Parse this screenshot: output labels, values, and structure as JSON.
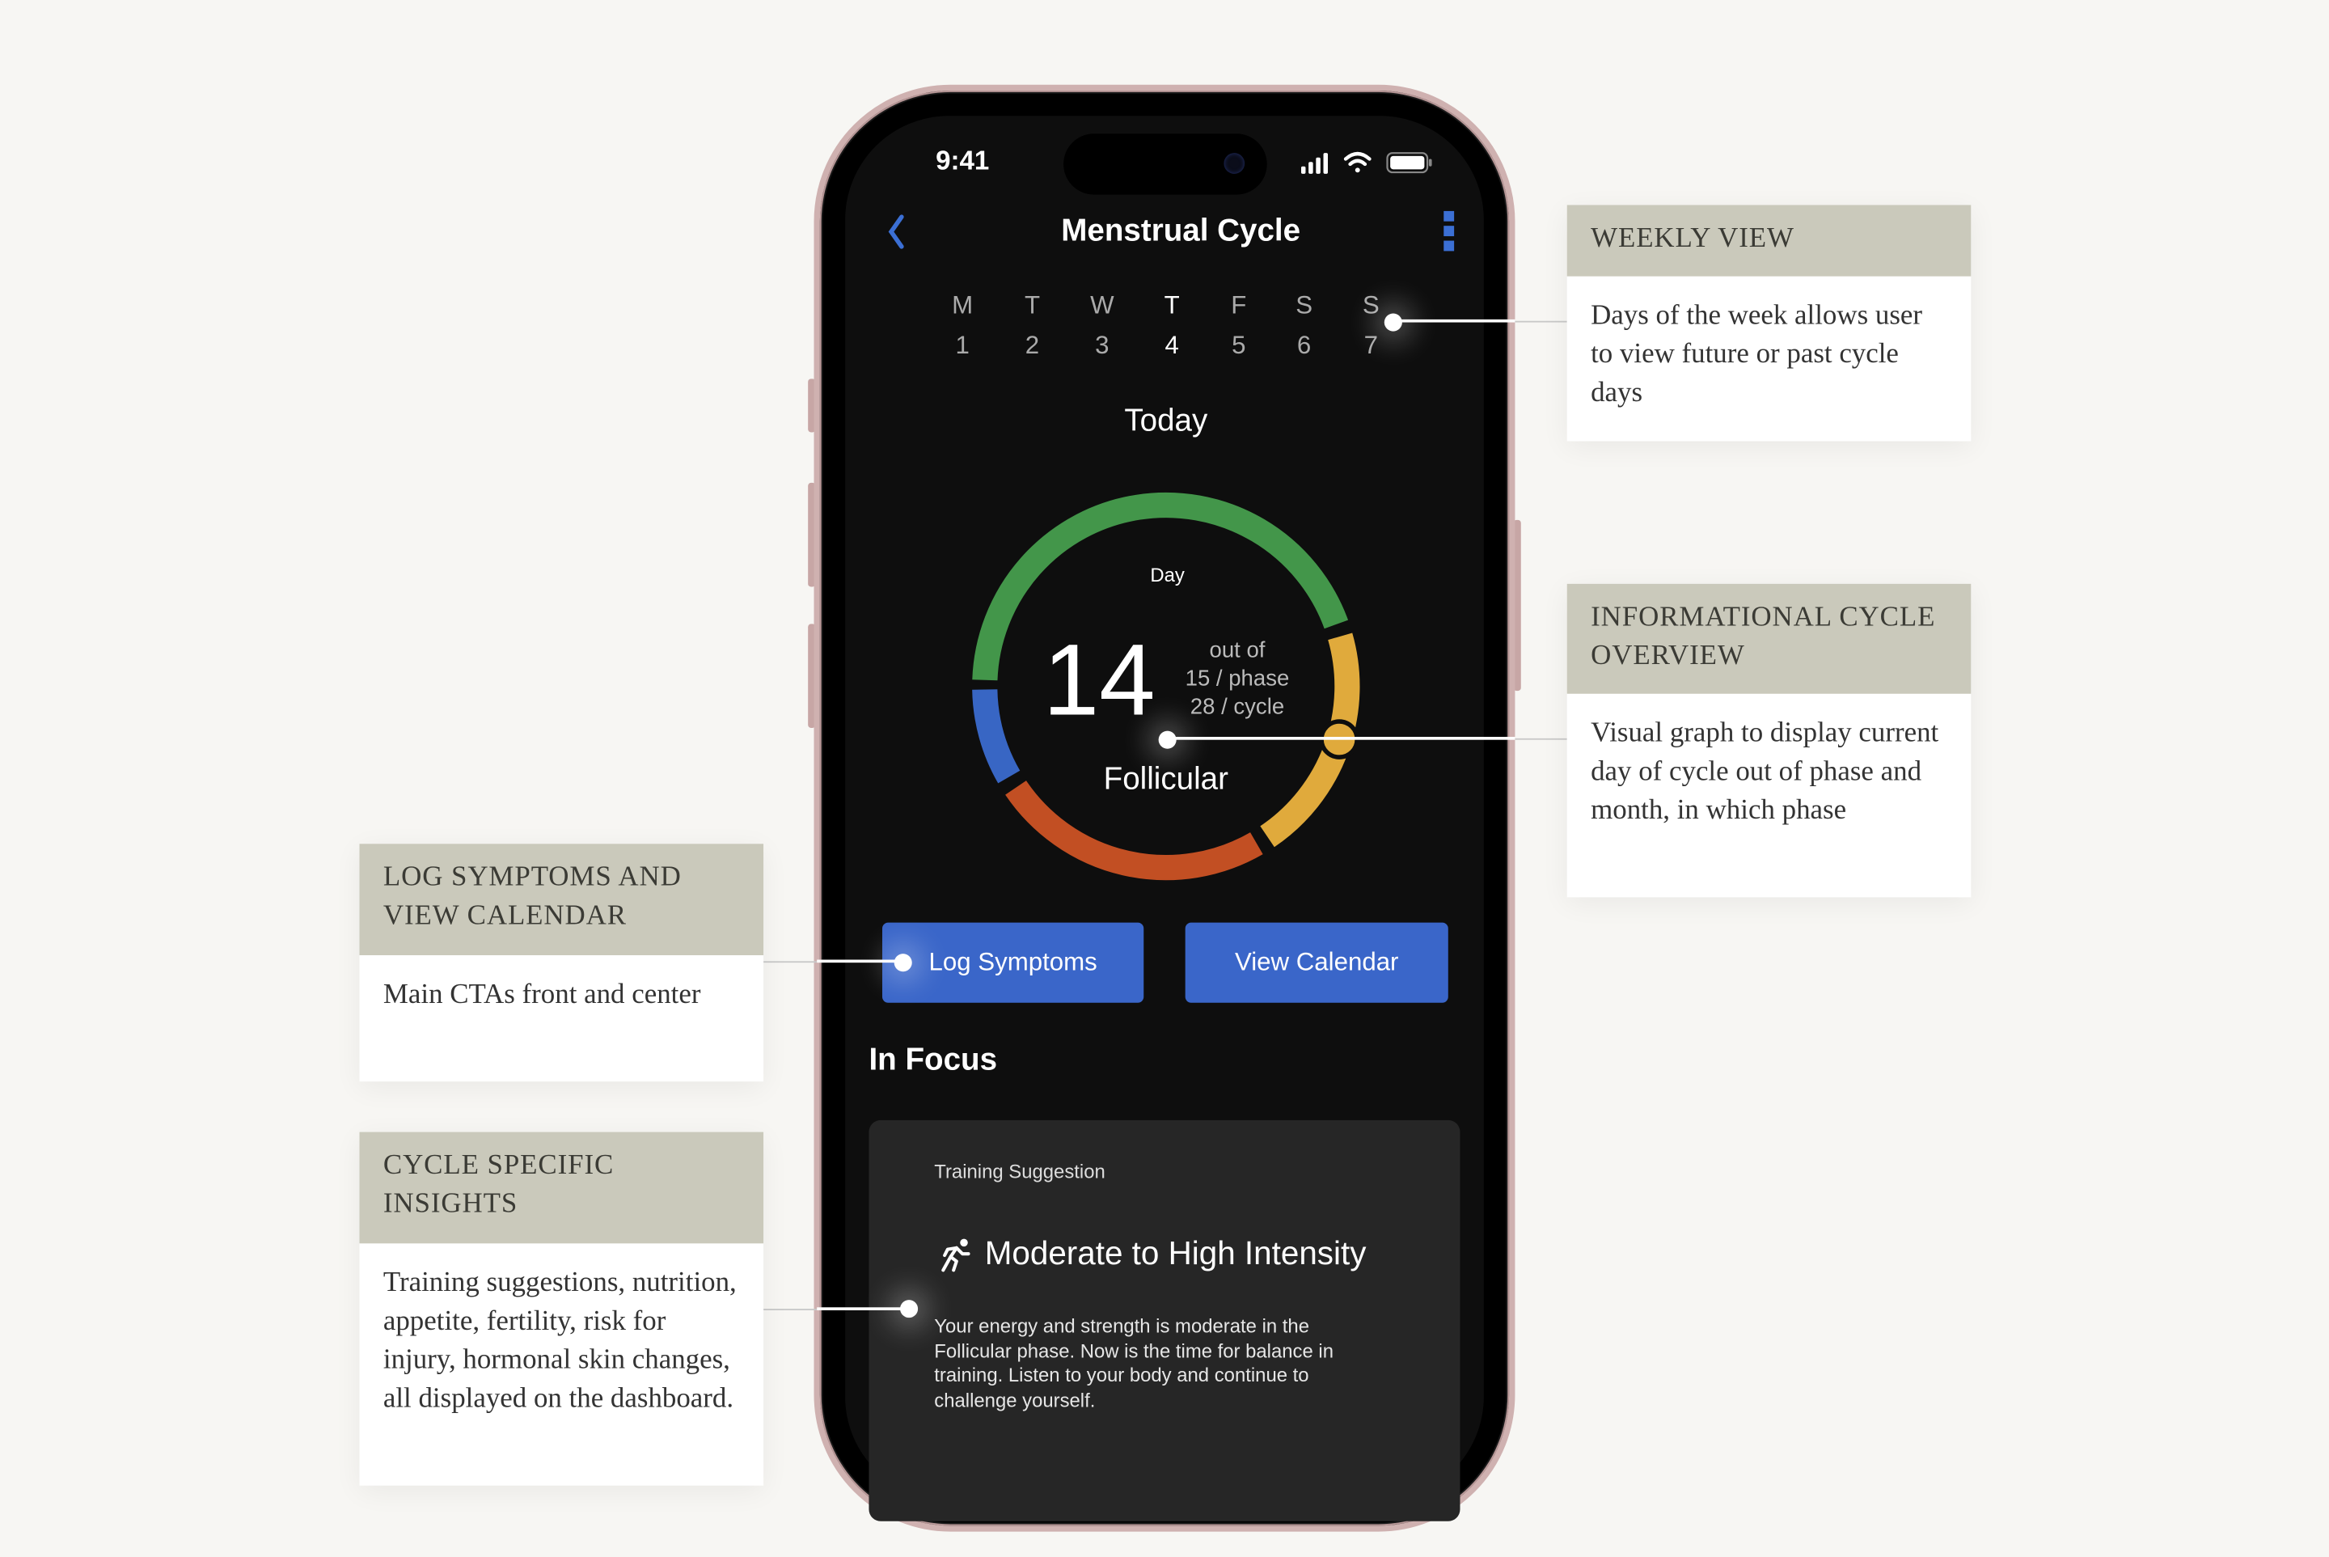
{
  "status_bar": {
    "time": "9:41",
    "icons": [
      "signal-icon",
      "wifi-icon",
      "battery-icon"
    ]
  },
  "header": {
    "title": "Menstrual Cycle",
    "back_icon": "chevron-left-icon",
    "menu_icon": "kebab-menu-icon"
  },
  "week": {
    "days": [
      {
        "letter": "M",
        "num": "1"
      },
      {
        "letter": "T",
        "num": "2"
      },
      {
        "letter": "W",
        "num": "3"
      },
      {
        "letter": "T",
        "num": "4",
        "current": true
      },
      {
        "letter": "F",
        "num": "5"
      },
      {
        "letter": "S",
        "num": "6"
      },
      {
        "letter": "S",
        "num": "7"
      }
    ]
  },
  "today_label": "Today",
  "cycle": {
    "day_label": "Day",
    "day": "14",
    "out_of": "out of",
    "phase_length": "15 / phase",
    "cycle_length": "28 / cycle",
    "phase_name": "Follicular",
    "colors": {
      "green": "#43964a",
      "yellow": "#e0aa3c",
      "red": "#c24f23",
      "blue": "#3866c4"
    }
  },
  "actions": {
    "log_symptoms": "Log Symptoms",
    "view_calendar": "View Calendar",
    "accent": "#3a66c9"
  },
  "in_focus": {
    "heading": "In Focus",
    "card": {
      "label": "Training Suggestion",
      "icon": "running-person-icon",
      "title": "Moderate to High Intensity",
      "body": "Your energy and strength is moderate in the Follicular phase. Now is the time for balance in training. Listen to your body and continue to challenge yourself."
    }
  },
  "annotations": {
    "weekly": {
      "title": "Weekly View",
      "body": "Days of the week allows user to view future or past cycle days"
    },
    "overview": {
      "title": "Informational Cycle Overview",
      "body": "Visual graph to display current day of cycle out of phase and month, in which phase"
    },
    "ctas": {
      "title": "Log Symptoms and View Calendar",
      "body": "Main CTAs front and center"
    },
    "insights": {
      "title": "Cycle Specific Insights",
      "body": "Training suggestions, nutrition, appetite, fertility, risk for injury, hormonal skin changes, all displayed on the dashboard."
    }
  }
}
